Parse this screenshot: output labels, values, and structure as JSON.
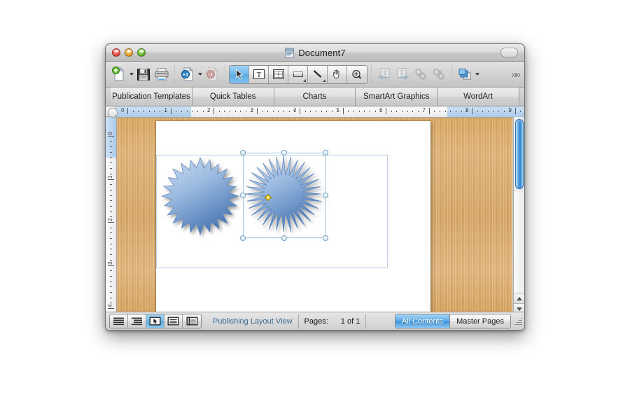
{
  "window": {
    "title": "Document7",
    "doc_icon": "word-document-icon",
    "buttons": {
      "close": "close-window-button",
      "minimize": "minimize-window-button",
      "zoom": "zoom-window-button",
      "toolbar_toggle": "toolbar-toggle-button"
    }
  },
  "toolbar": {
    "items": [
      {
        "name": "new-document-button",
        "glyph": "new-doc"
      },
      {
        "name": "new-document-dropdown",
        "glyph": "caret"
      },
      {
        "name": "save-button",
        "glyph": "save"
      },
      {
        "name": "print-button",
        "glyph": "print"
      },
      {
        "name": "add-page-button",
        "glyph": "add-page"
      },
      {
        "name": "add-page-dropdown",
        "glyph": "caret"
      },
      {
        "name": "remove-page-button",
        "glyph": "remove-page"
      }
    ],
    "tools": [
      {
        "name": "select-tool",
        "glyph": "arrow",
        "active": true,
        "submenu": false
      },
      {
        "name": "text-box-tool",
        "glyph": "textbox",
        "active": false,
        "submenu": false
      },
      {
        "name": "table-tool",
        "glyph": "table",
        "active": false,
        "submenu": false
      },
      {
        "name": "shape-tool",
        "glyph": "shape",
        "active": false,
        "submenu": true
      },
      {
        "name": "line-tool",
        "glyph": "line",
        "active": false,
        "submenu": true
      },
      {
        "name": "hand-tool",
        "glyph": "hand",
        "active": false,
        "submenu": false
      },
      {
        "name": "zoom-tool",
        "glyph": "magnifier",
        "active": false,
        "submenu": false
      }
    ],
    "right_items": [
      {
        "name": "text-flow-previous-button",
        "glyph": "flow-prev"
      },
      {
        "name": "text-flow-next-button",
        "glyph": "flow-next"
      },
      {
        "name": "link-text-boxes-button",
        "glyph": "link"
      },
      {
        "name": "unlink-text-boxes-button",
        "glyph": "unlink"
      },
      {
        "name": "arrange-button",
        "glyph": "arrange"
      },
      {
        "name": "arrange-dropdown",
        "glyph": "caret"
      }
    ],
    "overflow_label": "»»"
  },
  "gallery_tabs": [
    {
      "label": "Publication Templates",
      "name": "tab-publication-templates"
    },
    {
      "label": "Quick Tables",
      "name": "tab-quick-tables"
    },
    {
      "label": "Charts",
      "name": "tab-charts"
    },
    {
      "label": "SmartArt Graphics",
      "name": "tab-smartart-graphics"
    },
    {
      "label": "WordArt",
      "name": "tab-wordart"
    }
  ],
  "rulers": {
    "horizontal_numbers": [
      "0",
      "1",
      "2",
      "3",
      "4",
      "5",
      "6",
      "7",
      "8",
      "9"
    ],
    "vertical_numbers": [
      "0",
      "1",
      "2",
      "3",
      "4"
    ],
    "units": "inches"
  },
  "canvas": {
    "background": "wood-grain",
    "page_color": "#ffffff",
    "guide_box": "text-box-guide",
    "shapes": [
      {
        "name": "starburst-shape-unselected",
        "type": "starburst",
        "points": 24,
        "selected": false,
        "fill_start": "#c3d6ef",
        "fill_end": "#4c7ebb"
      },
      {
        "name": "starburst-shape-selected",
        "type": "starburst",
        "points": 32,
        "selected": true,
        "fill_start": "#c3d6ef",
        "fill_end": "#4c7ebb"
      }
    ],
    "selection": {
      "handle_count": 8,
      "adjust_handle": "yellow-diamond-adjust-handle",
      "handle_color": "#6d9ec9",
      "adjust_color": "#f0c419"
    }
  },
  "scrollbar": {
    "name": "vertical-scrollbar",
    "thumb_color": "#2d84d0",
    "up_arrow": "scroll-up-arrow",
    "down_arrow": "scroll-down-arrow"
  },
  "status_bar": {
    "view_buttons": [
      {
        "name": "draft-view-button",
        "glyph": "draft",
        "active": false
      },
      {
        "name": "outline-view-button",
        "glyph": "outline",
        "active": false
      },
      {
        "name": "publishing-layout-view-button",
        "glyph": "publishing",
        "active": true
      },
      {
        "name": "print-layout-view-button",
        "glyph": "printlayout",
        "active": false
      },
      {
        "name": "notebook-layout-view-button",
        "glyph": "notebook",
        "active": false
      }
    ],
    "view_label": "Publishing Layout View",
    "pages_label": "Pages:",
    "pages_value": "1 of 1",
    "segments": [
      {
        "label": "All Contents",
        "name": "segment-all-contents",
        "active": true
      },
      {
        "label": "Master Pages",
        "name": "segment-master-pages",
        "active": false
      }
    ],
    "resize_grip": "resize-grip"
  },
  "colors": {
    "accent": "#3d95de",
    "shape_fill": "#4c7ebb",
    "status_link": "#3f6c8e",
    "wood": "#d8a868"
  }
}
